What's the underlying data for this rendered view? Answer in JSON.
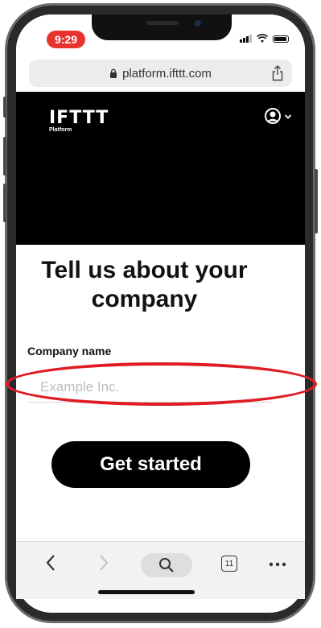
{
  "status_bar": {
    "time": "9:29"
  },
  "browser": {
    "url": "platform.ifttt.com"
  },
  "header": {
    "logo_word": "IFTTT",
    "logo_sub": "Platform"
  },
  "form": {
    "title_line1": "Tell us about your",
    "title_line2": "company",
    "company_label": "Company name",
    "company_placeholder": "Example Inc.",
    "company_value": "",
    "submit_label": "Get started"
  },
  "toolbar": {
    "tab_count": "11"
  },
  "colors": {
    "accent_annotation": "#e01b24",
    "time_pill": "#e8322f",
    "hero": "#000000"
  },
  "icons": [
    "lock-icon",
    "share-icon",
    "account-icon",
    "chevron-down-icon",
    "back-icon",
    "forward-icon",
    "search-icon",
    "tabs-icon",
    "more-icon"
  ]
}
